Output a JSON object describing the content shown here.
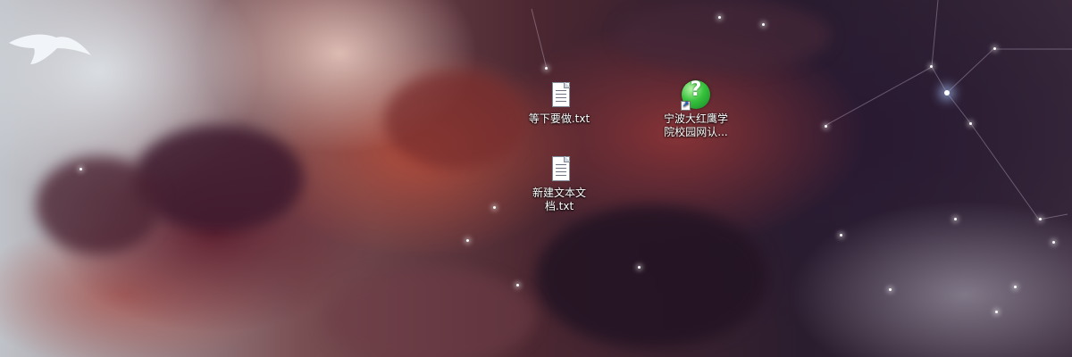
{
  "desktop": {
    "icons": [
      {
        "label": "等下要做.txt",
        "icon": "text-file-icon"
      },
      {
        "label": "新建文本文档.txt",
        "icon": "text-file-icon"
      },
      {
        "label": "宁波大红鹰学院校园网认...",
        "icon": "globe-question-icon",
        "shortcut": true
      }
    ]
  },
  "colors": {
    "icon_label_text": "#ffffff",
    "globe_green": "#37c23c"
  }
}
